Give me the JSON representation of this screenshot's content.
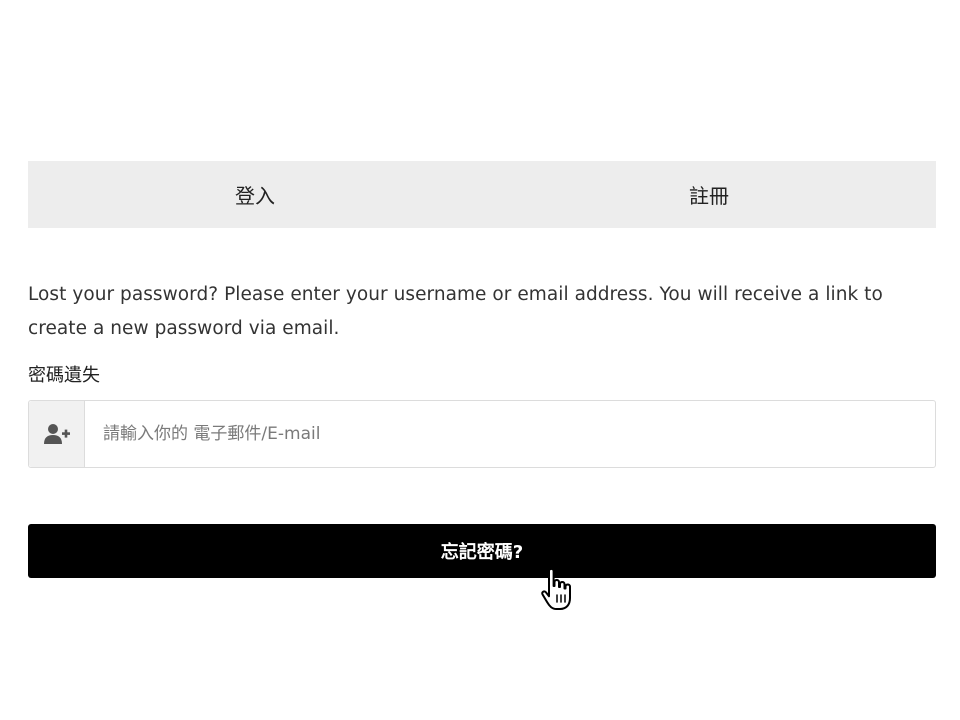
{
  "tabs": [
    {
      "label": "登入"
    },
    {
      "label": "註冊"
    }
  ],
  "form": {
    "description": "Lost your password? Please enter your username or email address. You will receive a link to create a new password via email.",
    "field_label": "密碼遺失",
    "email_placeholder": "請輸入你的 電子郵件/E-mail",
    "email_value": "",
    "input_icon": "user-plus-icon",
    "submit_label": "忘記密碼?"
  },
  "cursor_icon": "hand-pointer-icon",
  "colors": {
    "tab_background": "#ededed",
    "button_background": "#000000",
    "button_text": "#ffffff",
    "addon_background": "#f1f1f1",
    "border": "#dcdcdc"
  }
}
